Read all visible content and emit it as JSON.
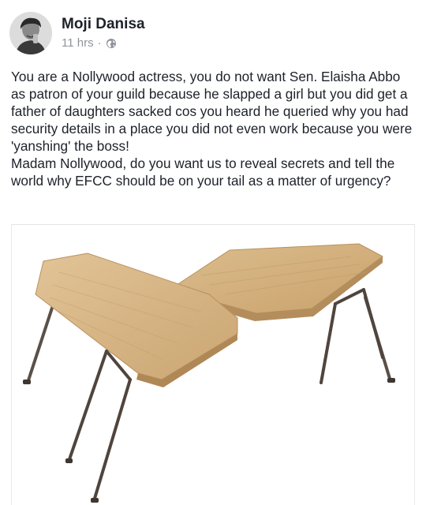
{
  "post": {
    "author": "Moji Danisa",
    "time": "11 hrs",
    "separator": "·",
    "privacy_icon": "globe-icon",
    "paragraphs": [
      "You are a Nollywood actress, you do not want Sen. Elaisha Abbo as patron of your guild because he slapped a girl but you did get a father of daughters sacked cos you heard he queried why you had security details in a place you did not even work because you were 'yanshing' the boss!",
      "Madam Nollywood, do you want us to reveal secrets and tell the world why EFCC should be on your tail as a matter of urgency?"
    ]
  },
  "colors": {
    "text": "#1d2129",
    "meta": "#90949c",
    "wood": "#d9b98a",
    "wood_edge": "#b8915f",
    "legs": "#5a5048"
  }
}
